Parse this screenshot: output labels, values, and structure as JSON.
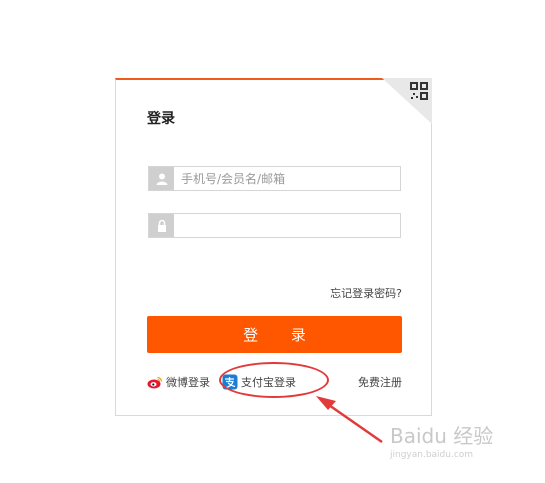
{
  "login": {
    "title": "登录",
    "username_placeholder": "手机号/会员名/邮箱",
    "password_value": "",
    "forgot_password": "忘记登录密码?",
    "submit_label": "登 录",
    "weibo_label": "微博登录",
    "alipay_label": "支付宝登录",
    "register_label": "免费注册"
  },
  "watermark": {
    "main": "Baidu 经验",
    "sub": "jingyan.baidu.com"
  },
  "colors": {
    "accent": "#ff5600",
    "top_border": "#f25a1a",
    "annotation": "#e23a3a",
    "icon_bg": "#cfcfcf"
  },
  "icons": [
    "qr-code-icon",
    "user-icon",
    "lock-icon",
    "weibo-icon",
    "alipay-icon"
  ]
}
